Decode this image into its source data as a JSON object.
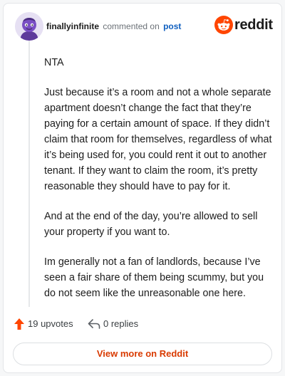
{
  "header": {
    "username": "finallyinfinite",
    "action_text": "commented on",
    "post_link": "post",
    "logo_text": "reddit"
  },
  "comment": {
    "paragraphs": [
      "NTA",
      "Just because it’s a room and not a whole separate apartment doesn’t change the fact that they’re paying for a certain amount of space. If they didn’t claim that room for themselves, regardless of what it’s being used for, you could rent it out to another tenant. If they want to claim the room, it’s pretty reasonable they should have to pay for it.",
      "And at the end of the day, you’re allowed to sell your property if you want to.",
      "Im generally not a fan of landlords, because I’ve seen a fair share of them being scummy, but you do not seem like the unreasonable one here."
    ]
  },
  "actions": {
    "upvotes": "19 upvotes",
    "replies": "0 replies"
  },
  "footer": {
    "view_more": "View more on Reddit"
  },
  "icons": {
    "upvote": "upvote-arrow-icon",
    "reply": "reply-arrow-icon",
    "logo": "reddit-snoo-icon"
  },
  "colors": {
    "accent": "#ff4500",
    "link": "#0f5fbf",
    "view_more": "#d93a00",
    "avatar": "#7a4fc4"
  }
}
